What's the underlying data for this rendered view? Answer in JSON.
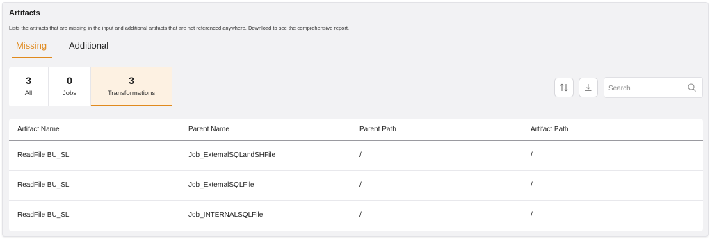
{
  "header": {
    "title": "Artifacts",
    "description": "Lists the artifacts that are missing in the input and additional artifacts that are not referenced anywhere. Download to see the comprehensive report."
  },
  "tabs": [
    {
      "label": "Missing",
      "active": true
    },
    {
      "label": "Additional",
      "active": false
    }
  ],
  "filters": [
    {
      "count": "3",
      "label": "All"
    },
    {
      "count": "0",
      "label": "Jobs"
    },
    {
      "count": "3",
      "label": "Transformations",
      "selected": true
    }
  ],
  "toolbar": {
    "sort_icon": "sort-icon",
    "download_icon": "download-icon",
    "search_placeholder": "Search"
  },
  "table": {
    "columns": [
      "Artifact Name",
      "Parent Name",
      "Parent Path",
      "Artifact Path"
    ],
    "rows": [
      [
        "ReadFile BU_SL",
        "Job_ExternalSQLandSHFile",
        "/",
        "/"
      ],
      [
        "ReadFile BU_SL",
        "Job_ExternalSQLFile",
        "/",
        "/"
      ],
      [
        "ReadFile BU_SL",
        "Job_INTERNALSQLFile",
        "/",
        "/"
      ]
    ]
  },
  "colors": {
    "accent": "#e08a1e",
    "selected_bg": "#fdf1e2",
    "panel_bg": "#f2f2f4"
  }
}
